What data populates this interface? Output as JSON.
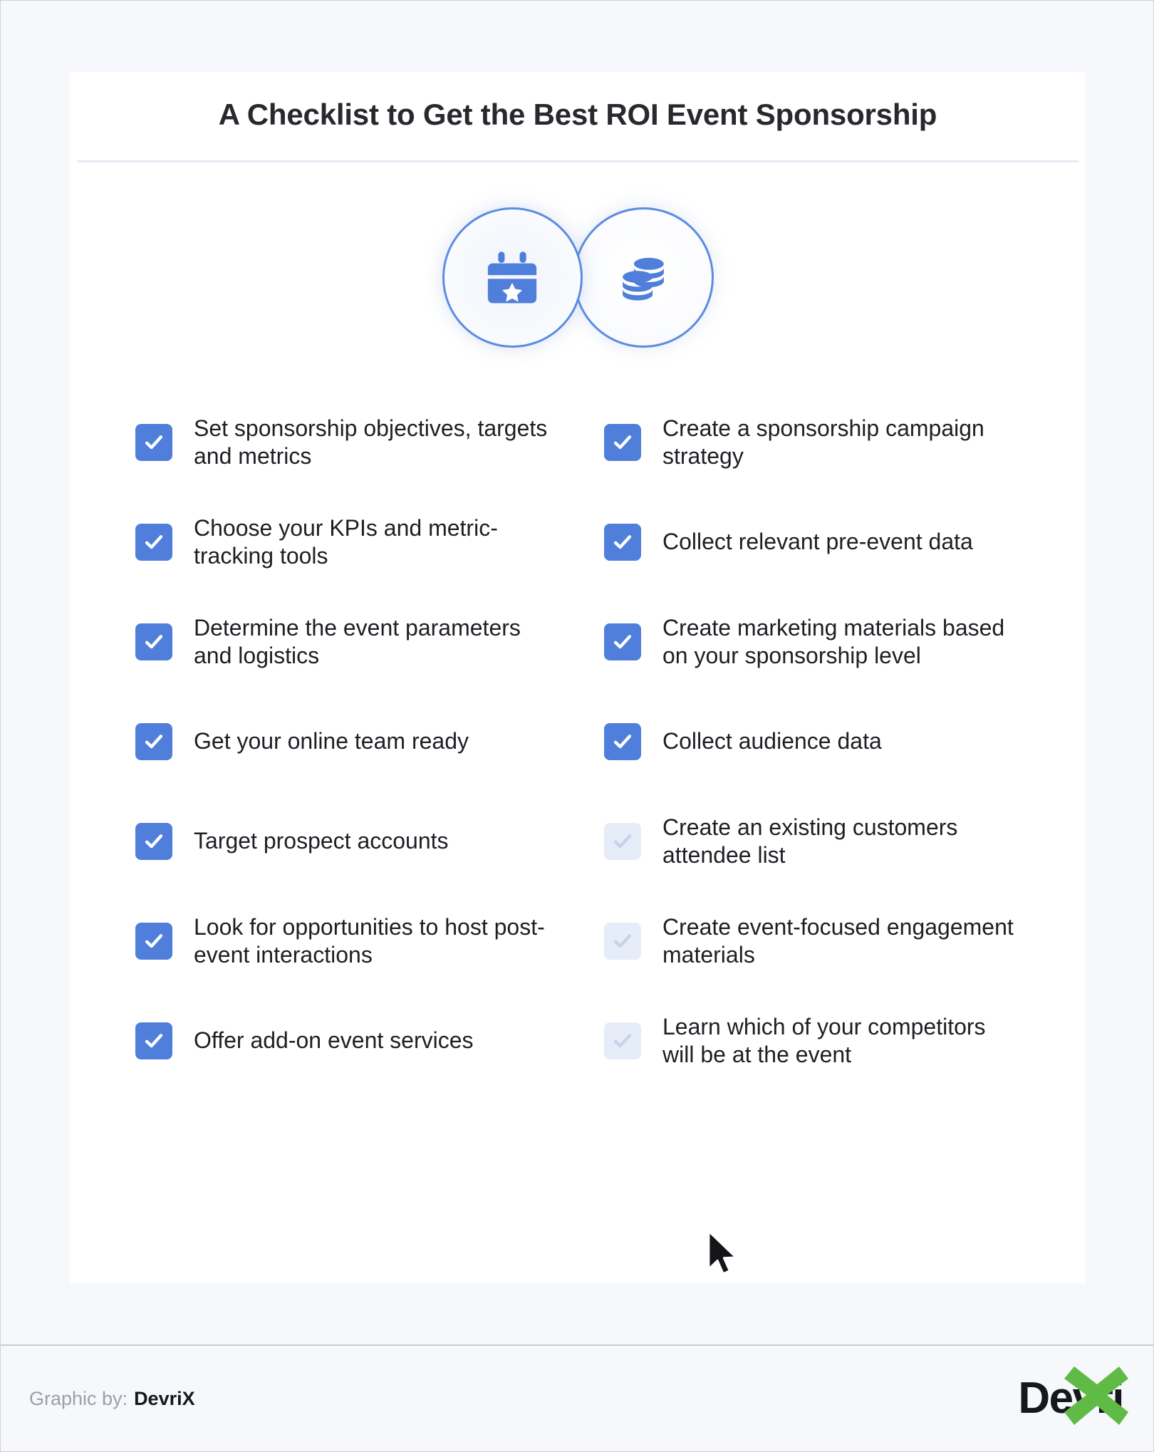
{
  "card": {
    "title": "A Checklist to Get the Best ROI Event Sponsorship"
  },
  "badges": [
    {
      "name": "calendar-star-icon",
      "label": "calendar-star"
    },
    {
      "name": "coins-icon",
      "label": "stacked-coins"
    }
  ],
  "checklist": {
    "left": [
      {
        "label": "Set sponsorship objectives, targets and metrics",
        "checked": true
      },
      {
        "label": "Choose your KPIs and metric-tracking tools",
        "checked": true
      },
      {
        "label": "Determine the event parameters and logistics",
        "checked": true
      },
      {
        "label": "Get your online team ready",
        "checked": true
      },
      {
        "label": "Target prospect accounts",
        "checked": true
      },
      {
        "label": "Look for opportunities to host post-event interactions",
        "checked": true
      },
      {
        "label": "Offer add-on event services",
        "checked": true
      }
    ],
    "right": [
      {
        "label": "Create a sponsorship campaign strategy",
        "checked": true
      },
      {
        "label": "Collect relevant pre-event data",
        "checked": true
      },
      {
        "label": "Create marketing materials based on your sponsorship level",
        "checked": true
      },
      {
        "label": "Collect audience data",
        "checked": true
      },
      {
        "label": "Create an existing customers attendee list",
        "checked": false
      },
      {
        "label": "Create event-focused engagement materials",
        "checked": false
      },
      {
        "label": "Learn which of your competitors will be at the event",
        "checked": false
      }
    ]
  },
  "footer": {
    "credit_prefix": "Graphic by:",
    "credit_brand": "DevriX",
    "logo_text": "Devri",
    "logo_mark": "X"
  },
  "colors": {
    "checkbox_checked": "#4f7edb",
    "checkbox_unchecked": "#e7ecf9",
    "badge_ring": "#5b8ce0",
    "icon_blue": "#4f7edb",
    "logo_green": "#5fbb46",
    "page_bg": "#f6f8fb",
    "card_bg": "#ffffff",
    "rule": "#e7eaf3"
  }
}
